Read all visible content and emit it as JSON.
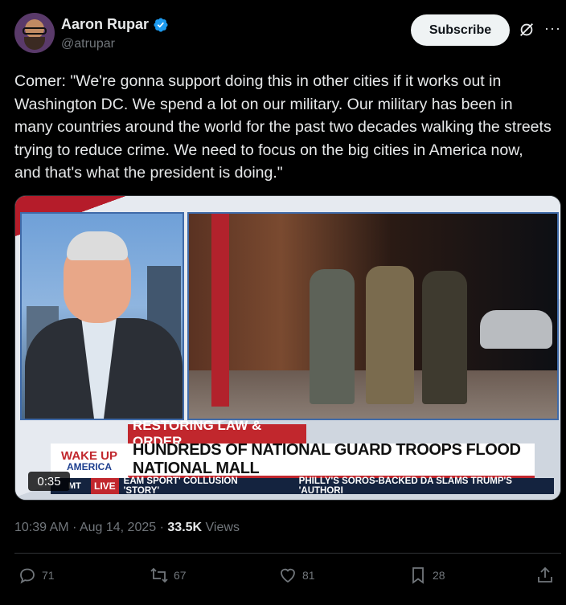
{
  "author": {
    "display_name": "Aaron Rupar",
    "handle": "@atrupar",
    "verified": true
  },
  "header": {
    "subscribe_label": "Subscribe",
    "grok_icon": "grok-icon",
    "more_icon": "more-icon",
    "more_glyph": "···"
  },
  "tweet": {
    "text": "Comer: \"We're gonna support doing this in other cities if it works out in Washington DC. We spend a lot on our military. Our military has been in many countries around the world for the past two decades walking the streets trying to reduce crime. We need to focus on the big cities in America now, and that's what the president is doing.\""
  },
  "video": {
    "duration": "0:35",
    "banner_top": "RESTORING LAW & ORDER",
    "banner_main": "HUNDREDS OF NATIONAL GUARD TROOPS FLOOD NATIONAL MALL",
    "logo_line1": "WAKE UP",
    "logo_line2": "AMERICA",
    "ticker_mt": "MT",
    "ticker_live": "LIVE",
    "ticker_item1": "EAM SPORT' COLLUSION 'STORY'",
    "ticker_item2": "PHILLY'S SOROS-BACKED DA SLAMS TRUMP'S 'AUTHORI",
    "accent_red": "#c1272d",
    "accent_blue": "#14233f"
  },
  "meta": {
    "time": "10:39 AM",
    "separator": "·",
    "date": "Aug 14, 2025",
    "views_count": "33.5K",
    "views_label": "Views"
  },
  "actions": {
    "replies": "71",
    "reposts": "67",
    "likes": "81",
    "bookmarks": "28"
  },
  "colors": {
    "background": "#000000",
    "text": "#e7e9ea",
    "muted": "#71767b",
    "verified": "#1d9bf0"
  }
}
